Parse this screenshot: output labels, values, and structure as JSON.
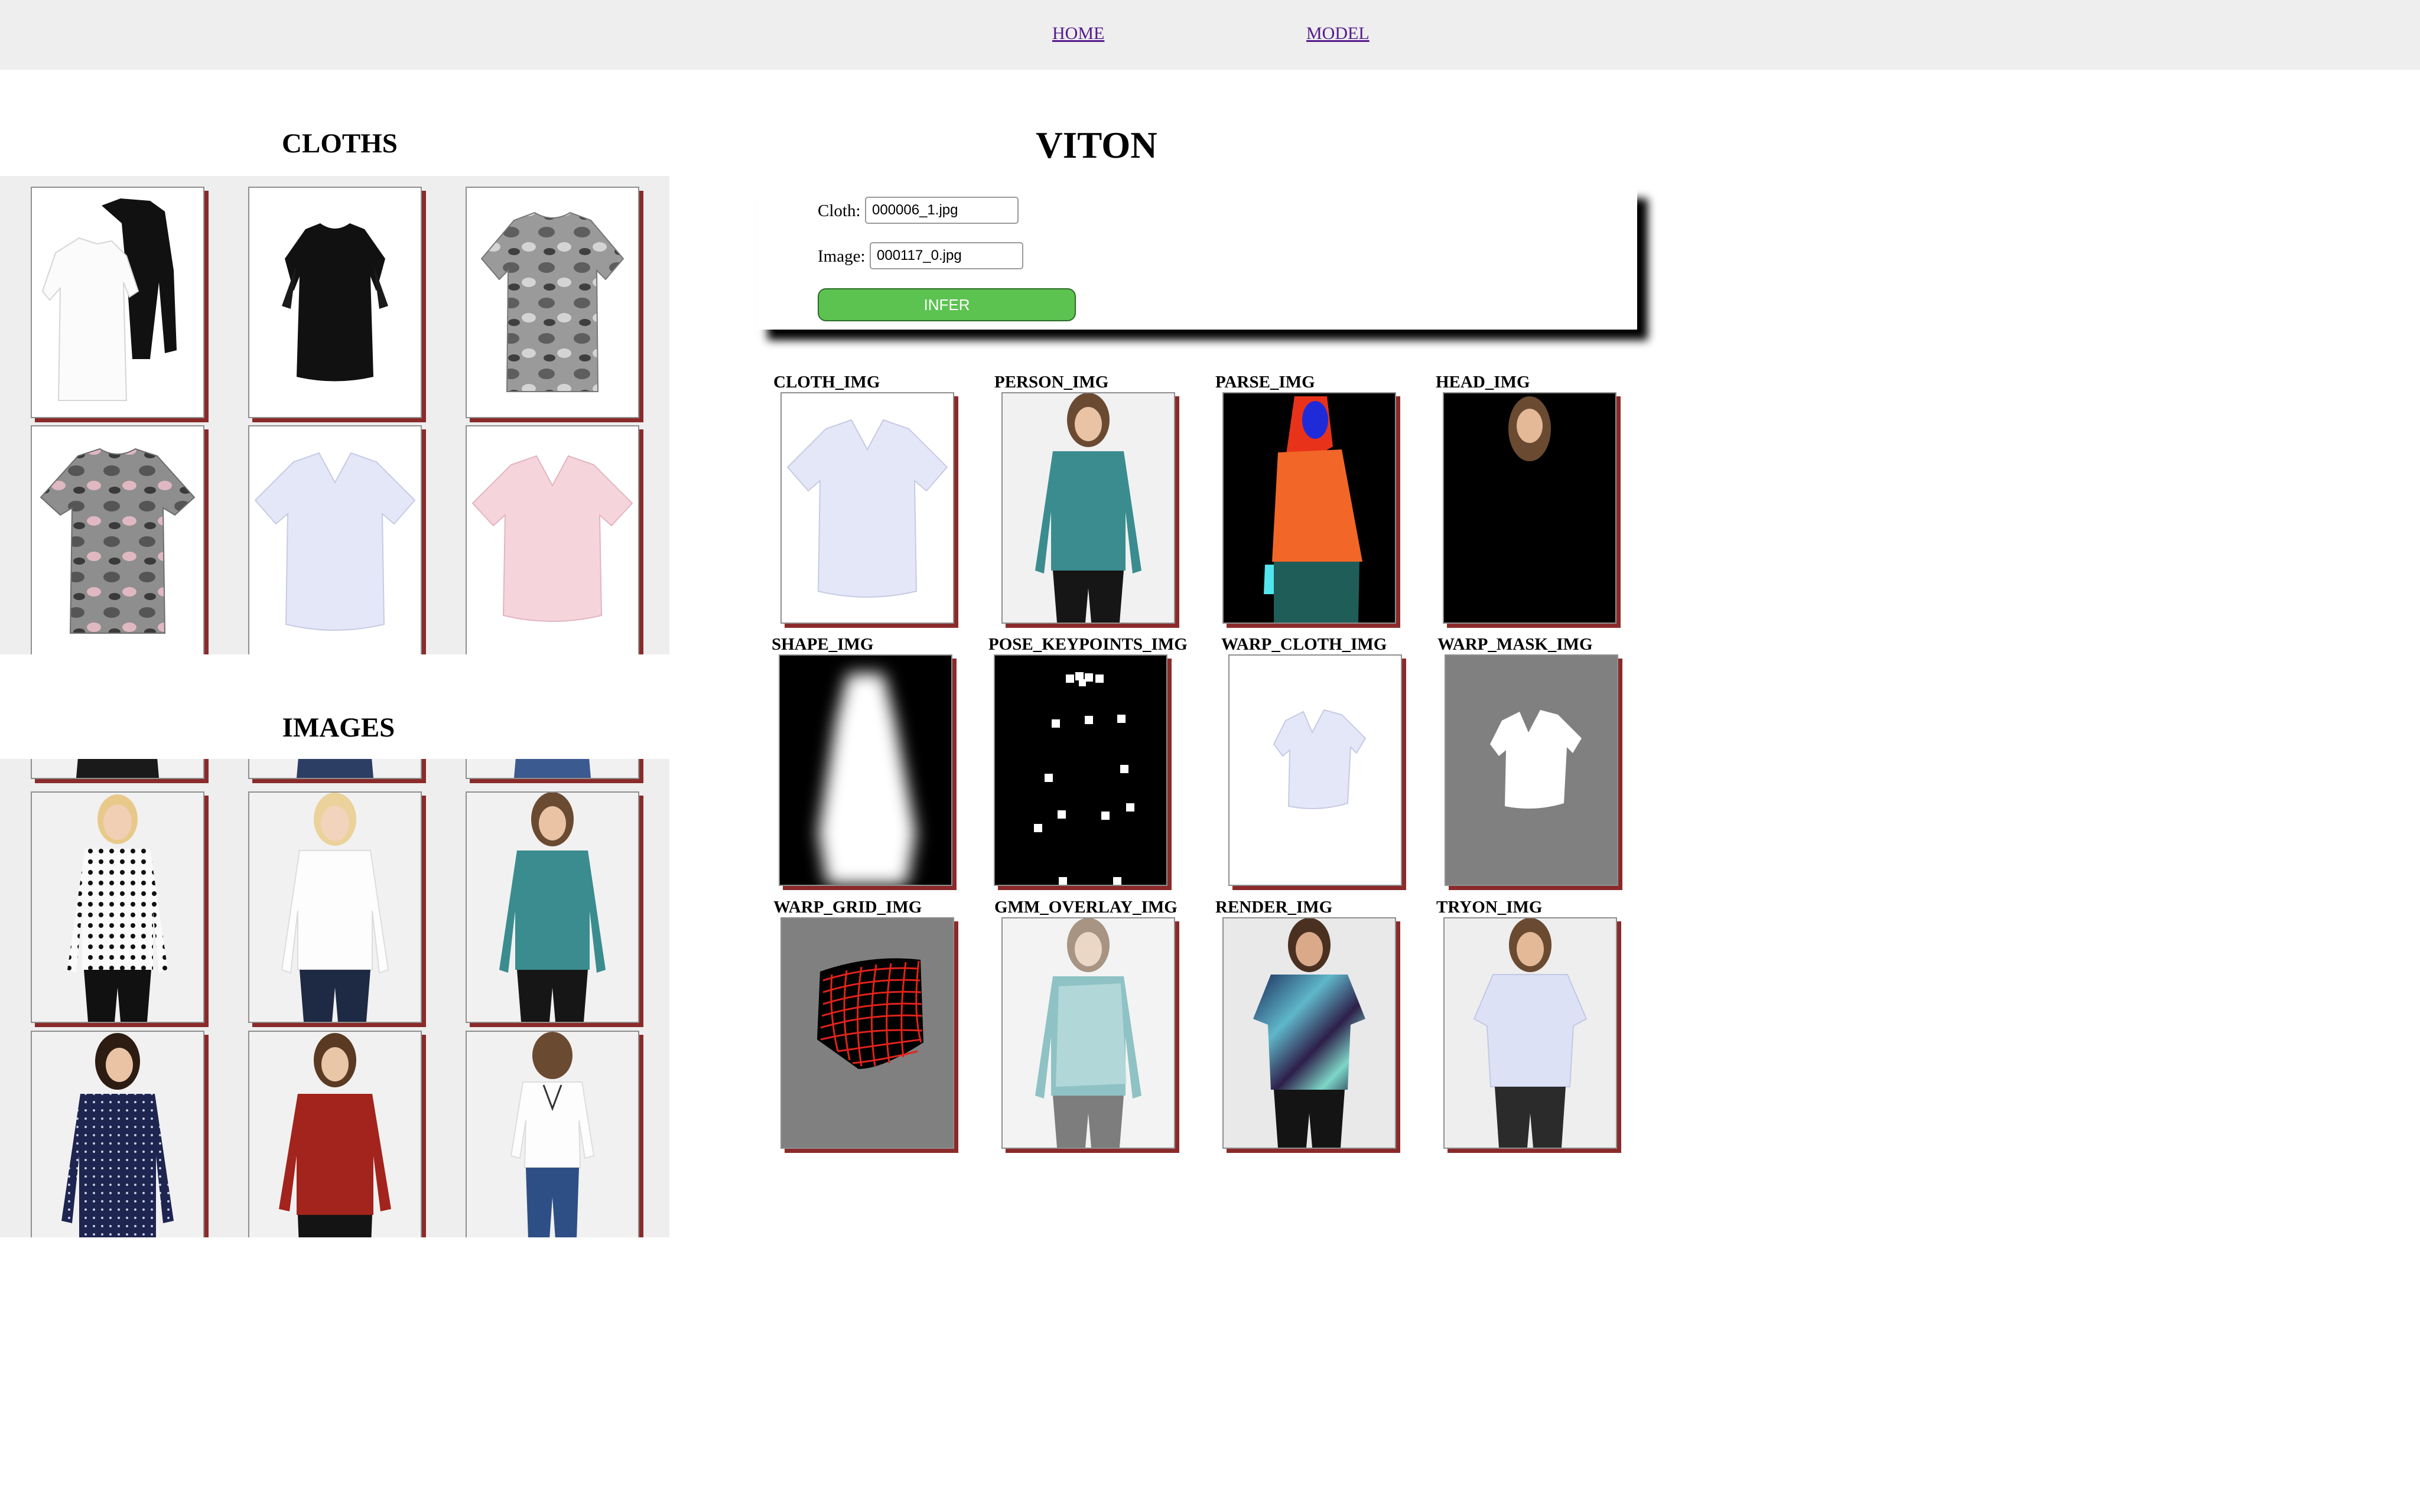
{
  "nav": {
    "home": "HOME",
    "model": "MODEL"
  },
  "cloths": {
    "title": "CLOTHS"
  },
  "images": {
    "title": "IMAGES"
  },
  "main": {
    "title": "VITON",
    "form": {
      "cloth_label": "Cloth:",
      "cloth_value": "000006_1.jpg",
      "image_label": "Image:",
      "image_value": "000117_0.jpg",
      "infer_label": "INFER"
    },
    "results": [
      "CLOTH_IMG",
      "PERSON_IMG",
      "PARSE_IMG",
      "HEAD_IMG",
      "SHAPE_IMG",
      "POSE_KEYPOINTS_IMG",
      "WARP_CLOTH_IMG",
      "WARP_MASK_IMG",
      "WARP_GRID_IMG",
      "GMM_OVERLAY_IMG",
      "RENDER_IMG",
      "TRYON_IMG"
    ]
  },
  "colors": {
    "accent_shadow": "#8b2a2a",
    "infer_button": "#5cc350",
    "link": "#551a8b"
  }
}
